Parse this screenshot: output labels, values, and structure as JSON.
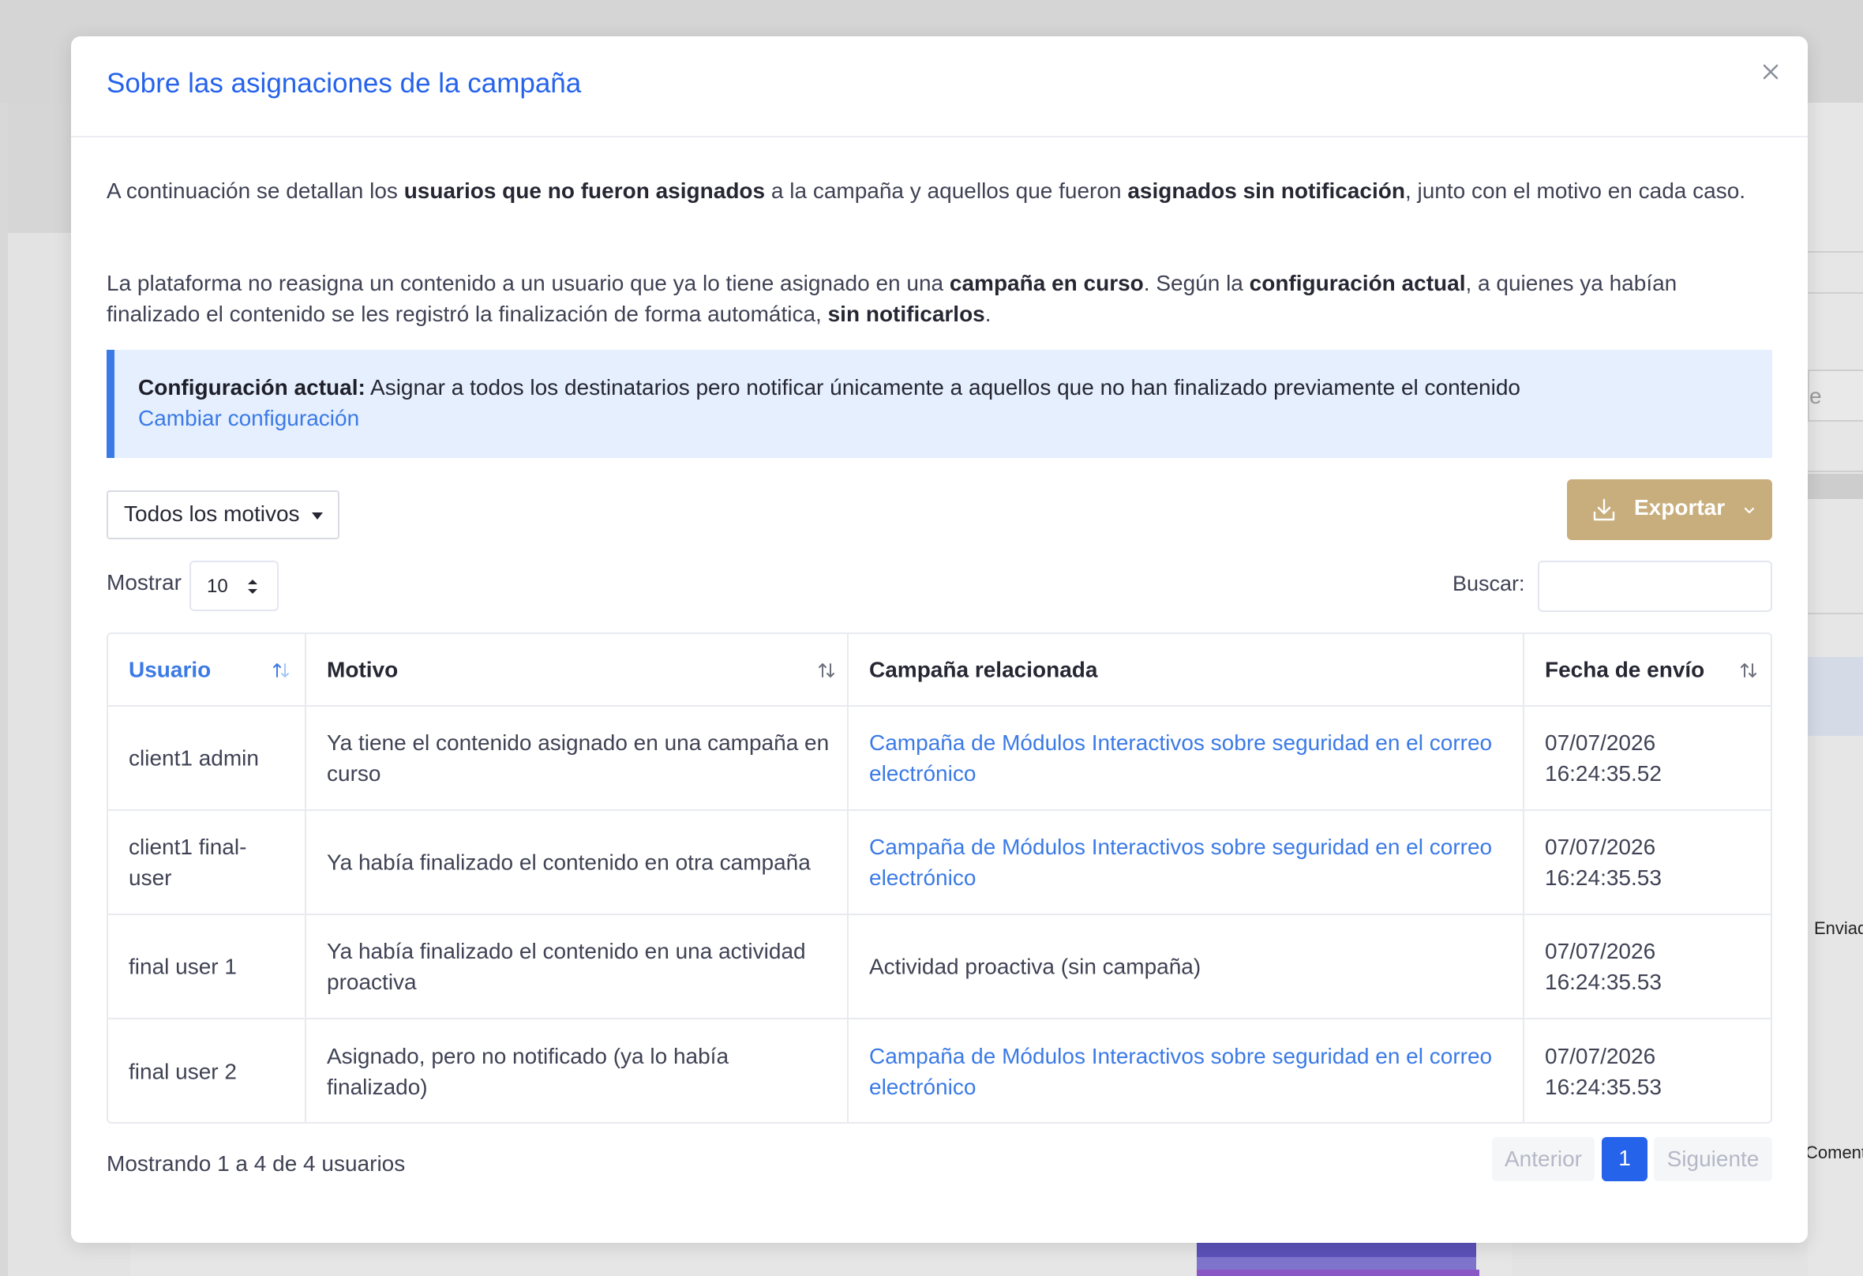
{
  "background": {
    "fragment_input_text": "e",
    "fragment_label_1": "Enviad",
    "fragment_label_2": "Coment"
  },
  "modal": {
    "title": "Sobre las asignaciones de la campaña",
    "intro": {
      "p1_a": "A continuación se detallan los ",
      "p1_b": "usuarios que no fueron asignados",
      "p1_c": " a la campaña y aquellos que fueron ",
      "p1_d": "asignados sin notificación",
      "p1_e": ", junto con el motivo en cada caso.",
      "p2_a": "La plataforma no reasigna un contenido a un usuario que ya lo tiene asignado en una ",
      "p2_b": "campaña en curso",
      "p2_c": ". Según la ",
      "p2_d": "configuración actual",
      "p2_e": ", a quienes ya habían finalizado el contenido se les registró la finalización de forma automática, ",
      "p2_f": "sin notificarlos",
      "p2_g": "."
    },
    "info_box": {
      "label": "Configuración actual:",
      "text": " Asignar a todos los destinatarios pero notificar únicamente a aquellos que no han finalizado previamente el contenido",
      "link": "Cambiar configuración"
    },
    "filter": {
      "selected": "Todos los motivos"
    },
    "export": {
      "label": "Exportar",
      "icon": "download-icon"
    },
    "length": {
      "label": "Mostrar",
      "value": "10"
    },
    "search": {
      "label": "Buscar:",
      "value": "",
      "placeholder": ""
    },
    "table": {
      "headers": [
        "Usuario",
        "Motivo",
        "Campaña relacionada",
        "Fecha de envío"
      ],
      "rows": [
        {
          "user": "client1 admin",
          "reason": "Ya tiene el contenido asignado en una campaña en curso",
          "campaign": "Campaña de Módulos Interactivos sobre seguridad en el correo electrónico",
          "campaign_is_link": true,
          "date": "07/07/2026",
          "time": "16:24:35.52"
        },
        {
          "user": "client1 final-user",
          "reason": "Ya había finalizado el contenido en otra campaña",
          "campaign": "Campaña de Módulos Interactivos sobre seguridad en el correo electrónico",
          "campaign_is_link": true,
          "date": "07/07/2026",
          "time": "16:24:35.53"
        },
        {
          "user": "final user 1",
          "reason": "Ya había finalizado el contenido en una actividad proactiva",
          "campaign": "Actividad proactiva (sin campaña)",
          "campaign_is_link": false,
          "date": "07/07/2026",
          "time": "16:24:35.53"
        },
        {
          "user": "final user 2",
          "reason": "Asignado, pero no notificado (ya lo había finalizado)",
          "campaign": "Campaña de Módulos Interactivos sobre seguridad en el correo electrónico",
          "campaign_is_link": true,
          "date": "07/07/2026",
          "time": "16:24:35.53"
        }
      ]
    },
    "footer": {
      "info": "Mostrando 1 a 4 de 4 usuarios",
      "prev": "Anterior",
      "current_page": "1",
      "next": "Siguiente"
    }
  },
  "colors": {
    "accent": "#2563eb",
    "link": "#3b7ae6",
    "export_button": "#c9ae7d",
    "info_background": "#e5effd"
  }
}
